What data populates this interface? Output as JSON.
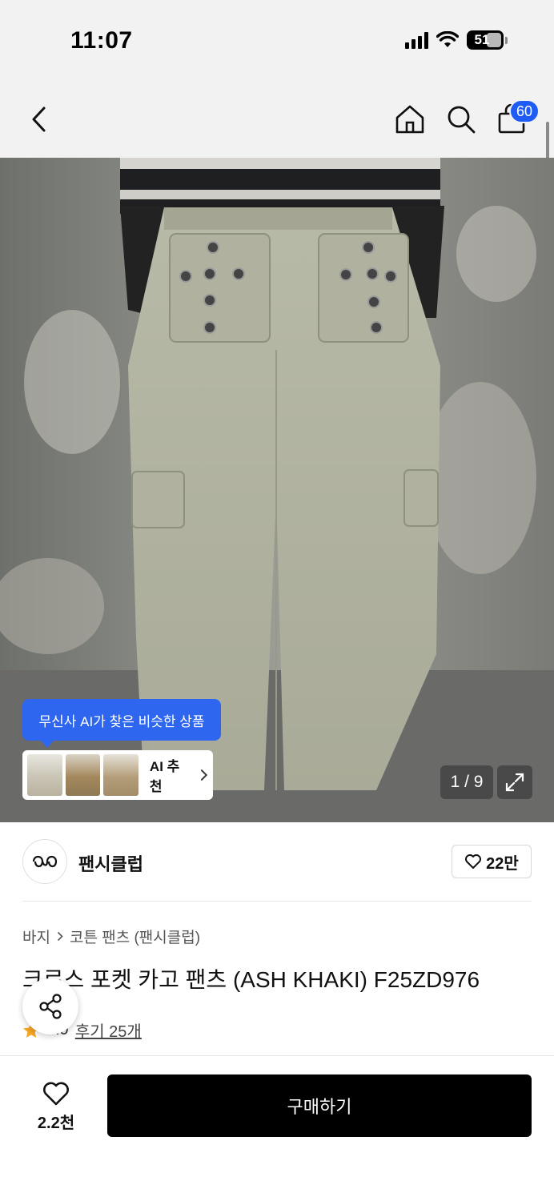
{
  "status_bar": {
    "time": "11:07",
    "battery": "51"
  },
  "nav": {
    "cart_count": "60",
    "icons": [
      "back-icon",
      "home-icon",
      "search-icon",
      "shopping-bag-icon"
    ]
  },
  "hero": {
    "ai_tooltip": "무신사 AI가 찾은 비슷한 상품",
    "ai_recommend_label": "AI 추천",
    "page_counter": "1 / 9"
  },
  "brand": {
    "name": "팬시클럽",
    "likes": "22만"
  },
  "product": {
    "breadcrumb": [
      "바지",
      "코튼 팬츠 (팬시클럽)"
    ],
    "title": "크로스 포켓 카고 팬츠 (ASH KHAKI) F25ZD976",
    "rating": "4.9",
    "reviews": "후기 25개"
  },
  "bottom": {
    "wish_count": "2.2천",
    "buy_label": "구매하기"
  },
  "colors": {
    "accent_blue": "#2e66f0",
    "badge_blue": "#1f5cf5",
    "buy_button": "#000000",
    "star": "#f5a623"
  }
}
